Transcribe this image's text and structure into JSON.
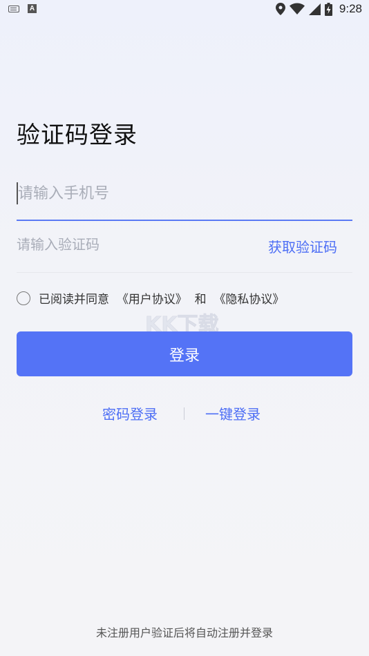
{
  "status_bar": {
    "time": "9:28"
  },
  "title": "验证码登录",
  "phone_input": {
    "placeholder": "请输入手机号",
    "value": ""
  },
  "code_input": {
    "placeholder": "请输入验证码",
    "value": ""
  },
  "get_code_label": "获取验证码",
  "agreement": {
    "prefix": "已阅读并同意",
    "user_agreement": "《用户协议》",
    "conjunction": "和",
    "privacy_agreement": "《隐私协议》"
  },
  "login_button_label": "登录",
  "alt_login": {
    "password": "密码登录",
    "one_click": "一键登录"
  },
  "footer_note": "未注册用户验证后将自动注册并登录",
  "colors": {
    "accent": "#4d6ef5",
    "button": "#5473f6"
  }
}
